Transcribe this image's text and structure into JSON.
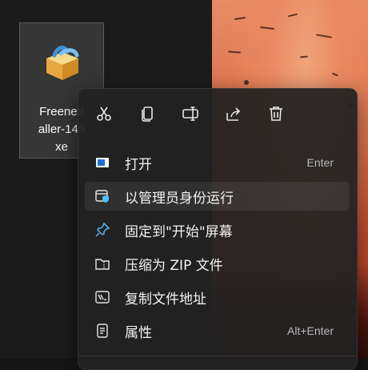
{
  "desktop": {
    "file_icon": {
      "name": "installer-package-icon",
      "label": "FreenetI\naller-149\nxe"
    }
  },
  "menu": {
    "toolbar": [
      {
        "name": "cut-icon"
      },
      {
        "name": "copy-icon"
      },
      {
        "name": "rename-icon"
      },
      {
        "name": "share-icon"
      },
      {
        "name": "delete-icon"
      }
    ],
    "items": [
      {
        "label": "打开",
        "shortcut": "Enter",
        "icon": "open-icon"
      },
      {
        "label": "以管理员身份运行",
        "shortcut": "",
        "icon": "run-as-admin-icon"
      },
      {
        "label": "固定到\"开始\"屏幕",
        "shortcut": "",
        "icon": "pin-icon"
      },
      {
        "label": "压缩为 ZIP 文件",
        "shortcut": "",
        "icon": "zip-folder-icon"
      },
      {
        "label": "复制文件地址",
        "shortcut": "",
        "icon": "copy-path-icon"
      },
      {
        "label": "属性",
        "shortcut": "Alt+Enter",
        "icon": "properties-icon"
      }
    ]
  },
  "colors": {
    "menu_bg": "#222222",
    "accent": "#4cc2ff",
    "wallpaper": "#db6e4a"
  }
}
